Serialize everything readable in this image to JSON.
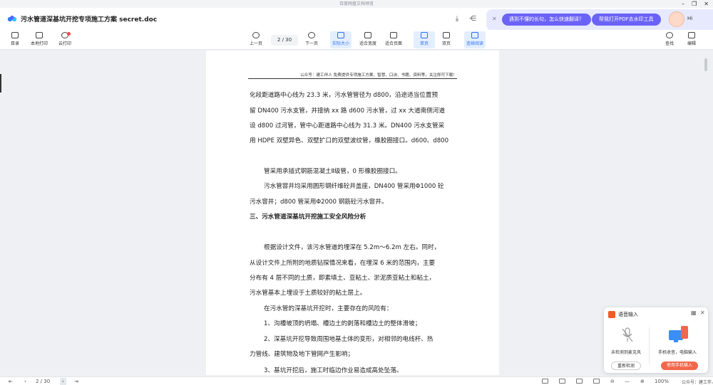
{
  "window": {
    "title": "百度网盘文档预览"
  },
  "header": {
    "doc_title": "污水管道深基坑开挖专项施工方案 secret.doc"
  },
  "promo": {
    "pill1": "遇到不懂的长句，怎么快速翻译？",
    "pill2": "帮我打开PDF去水印工具",
    "avatar_label": "Hi"
  },
  "toolbar": {
    "catalog": "目录",
    "local_print": "本地打印",
    "cloud_print": "云打印",
    "prev_page": "上一页",
    "page_indicator": "2 / 30",
    "next_page": "下一页",
    "actual_size": "实际大小",
    "fit_width": "适合宽度",
    "fit_page": "适合页面",
    "single_page": "单页",
    "double_page": "双页",
    "continuous": "连续阅读",
    "search": "查找",
    "edit": "编辑"
  },
  "document": {
    "page_header": "公众号：建工伴人 免费提供专项施工方案、智慧、口诀、书籍、资料等，关注即可下载！",
    "lines": [
      "化段距道路中心线为 23.3 米，污水管管径为 d800，沿途适当位置预",
      "留 DN400 污水支管，并接纳 xx 路 d600 污水管，过 xx 大道南侧河道",
      "设 d800 过河管，管中心距道路中心线为 31.3 米。DN400 污水支管采",
      "用 HDPE 双壁异色、双壁扩口的双壁波纹管，橡胶圈接口。d600、d800",
      "管采用承插式钢筋混凝土Ⅱ级管，0 形橡胶圈接口。",
      "污水管窨井均采用圆形钢纤维砼井盖座，DN400 管采用Φ1000 砼",
      "污水窨井；d800 管采用Φ2000 钢筋砼污水窨井。",
      "三、污水管道深基坑开挖施工安全风险分析",
      "根据设计文件，该污水管道的埋深在 5.2m～6.2m 左右。同时，",
      "从设计文件上所附的地质钻探情况来看，在埋深 6 米的范围内，主要",
      "分布有 4 层不同的土质，即素填土、亚粘土、淤泥质亚粘土和粘土，",
      "污水管基本上埋设于土质较好的粘土层上。",
      "在污水管的深基坑开挖时，主要存在的风险有：",
      "1、沟槽坡顶的坍塌、槽边土的剥落和槽边土的整体滑坡；",
      "2、深基坑开挖导致周围地基土体的变形，对相邻的电线杆、热",
      "力管线、建筑物及地下管网产生影响；",
      "3、基坑开挖后，施工时临边作业易造成高处坠落。"
    ]
  },
  "statusbar": {
    "page_indicator": "2 / 30",
    "zoom": "100%"
  },
  "voice_panel": {
    "title": "语音输入",
    "left_label": "未检测到麦克风",
    "right_label": "手机收音，电脑输入",
    "btn_retry": "重新检测",
    "btn_use_phone": "使用手机输入"
  },
  "watermark": "公众号：建工伴人"
}
